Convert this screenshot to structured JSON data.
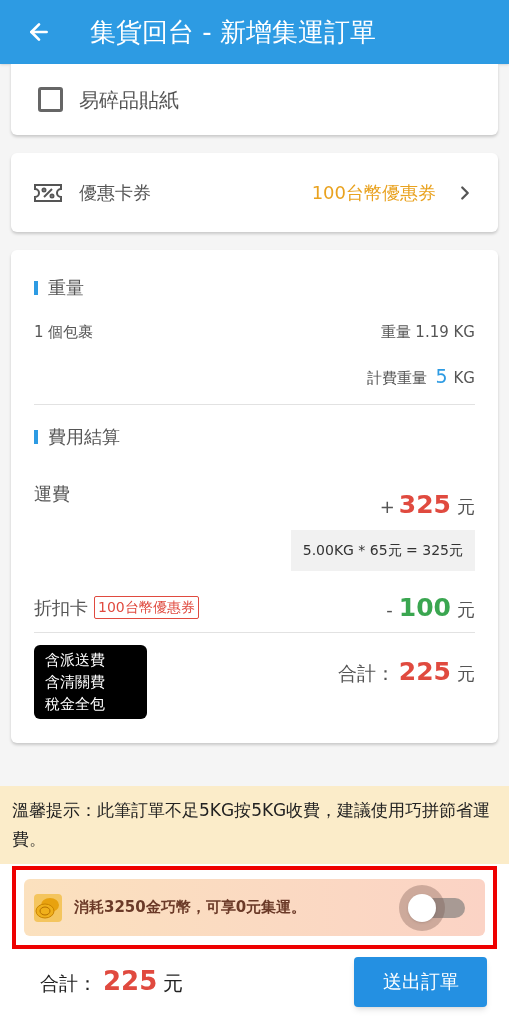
{
  "header": {
    "title": "集貨回台 - 新增集運訂單"
  },
  "fragile_sticker": {
    "label": "易碎品貼紙",
    "checked": false
  },
  "coupon": {
    "label": "優惠卡券",
    "value": "100台幣優惠券"
  },
  "weight": {
    "heading": "重量",
    "packages": "1 個包裹",
    "actual_label": "重量",
    "actual_value": "1.19 KG",
    "billing_label": "計費重量",
    "billing_value": "5",
    "billing_unit": "KG"
  },
  "fees": {
    "heading": "費用結算",
    "shipping": {
      "label": "運費",
      "sign": "+",
      "amount": "325",
      "unit": "元",
      "formula": "5.00KG * 65元 = 325元"
    },
    "discount": {
      "label": "折扣卡",
      "tag": "100台幣優惠券",
      "sign": "-",
      "amount": "100",
      "unit": "元"
    },
    "includes": [
      "含派送費",
      "含清關費",
      "稅金全包"
    ],
    "total": {
      "label": "合計：",
      "amount": "225",
      "unit": "元"
    }
  },
  "tip": "溫馨提示：此筆訂單不足5KG按5KG收費，建議使用巧拼節省運費。",
  "coin_offer": {
    "text": "消耗3250金巧幣，可享0元集運。",
    "on": false
  },
  "footer": {
    "total_label": "合計：",
    "total_amount": "225",
    "total_unit": "元",
    "submit": "送出訂單"
  }
}
